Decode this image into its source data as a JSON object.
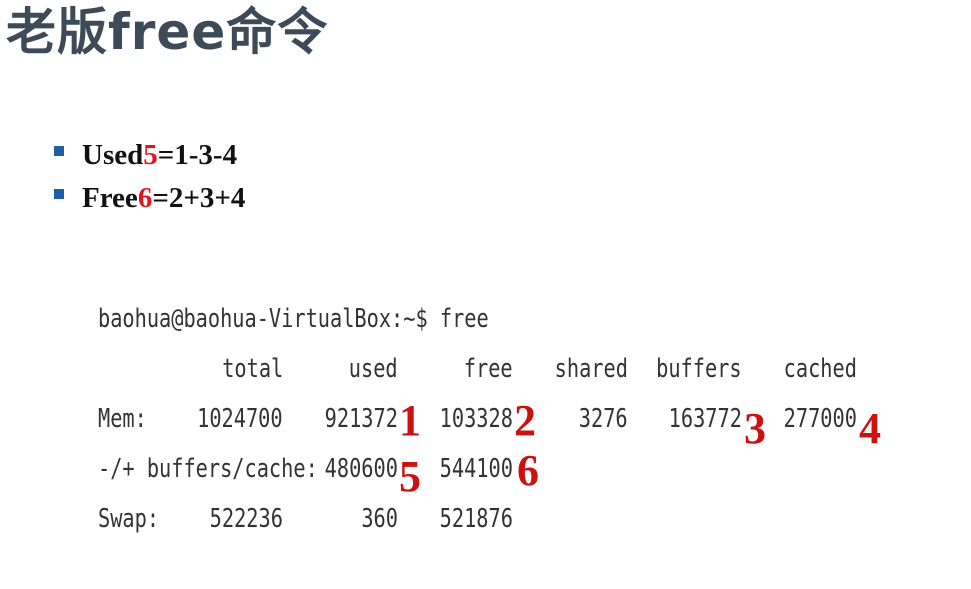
{
  "title": "老版free命令",
  "bullets": [
    {
      "prefix": "Used",
      "number": "5",
      "formula": "=1-3-4"
    },
    {
      "prefix": "Free",
      "number": "6",
      "formula": "=2+3+4"
    }
  ],
  "terminal": {
    "prompt": "baohua@baohua-VirtualBox:~$ free",
    "headers": [
      "total",
      "used",
      "free",
      "shared",
      "buffers",
      "cached"
    ],
    "rows": [
      {
        "label": "Mem:",
        "total": "1024700",
        "used": "921372",
        "free": "103328",
        "shared": "3276",
        "buffers": "163772",
        "cached": "277000"
      },
      {
        "label": "-/+ buffers/cache:",
        "used": "480600",
        "free": "544100"
      },
      {
        "label": "Swap:",
        "total": "522236",
        "used": "360",
        "free": "521876"
      }
    ],
    "markers": [
      "1",
      "2",
      "3",
      "4",
      "5",
      "6"
    ]
  },
  "colors": {
    "title": "#3d4a57",
    "bullet": "#1f5fa8",
    "accent": "#e0161c",
    "terminal_text": "#333333"
  }
}
